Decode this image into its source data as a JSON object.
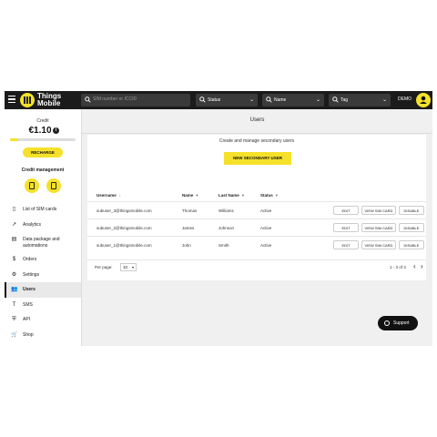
{
  "brand": {
    "logo_text": "Things Mobile"
  },
  "header": {
    "search_placeholder": "SIM number or ICCID",
    "filters": [
      {
        "label": "Status",
        "icon": "search-icon"
      },
      {
        "label": "Name",
        "icon": "search-icon"
      },
      {
        "label": "Tag",
        "icon": "search-icon"
      }
    ],
    "account_label": "DEMO"
  },
  "sidebar": {
    "credit_label": "Credit",
    "credit_value": "€1.10",
    "credit_fill_fraction": 0.12,
    "recharge_label": "RECHARGE",
    "credit_management_label": "Credit management",
    "items": [
      {
        "label": "List of SIM cards",
        "icon": "sim-card-icon"
      },
      {
        "label": "Analytics",
        "icon": "analytics-icon"
      },
      {
        "label": "Data package and automations",
        "icon": "data-package-icon"
      },
      {
        "label": "Orders",
        "icon": "dollar-icon"
      },
      {
        "label": "Settings",
        "icon": "gear-icon"
      },
      {
        "label": "Users",
        "icon": "users-icon",
        "active": true
      },
      {
        "label": "SMS",
        "icon": "sms-icon"
      },
      {
        "label": "API",
        "icon": "api-shield-icon"
      },
      {
        "label": "Shop",
        "icon": "cart-icon"
      }
    ]
  },
  "main": {
    "title": "Users",
    "subtitle": "Create and manage secondary users",
    "new_user_label": "NEW SECONDARY USER",
    "table": {
      "columns": [
        "Username",
        "Name",
        "Last Name",
        "Status"
      ],
      "rows": [
        {
          "username": "subuser_3@thingsmobile.com",
          "name": "Thomas",
          "last_name": "Williams",
          "status": "Active"
        },
        {
          "username": "subuser_2@thingsmobile.com",
          "name": "James",
          "last_name": "Johnson",
          "status": "Active"
        },
        {
          "username": "subuser_1@thingsmobile.com",
          "name": "John",
          "last_name": "Smith",
          "status": "Active"
        }
      ],
      "row_actions": [
        "EDIT",
        "VIEW SIM CARD",
        "DISABLE"
      ]
    },
    "pagination": {
      "per_page_label": "Per page:",
      "per_page_value": "10",
      "range_label": "1 - 3 of 3"
    }
  },
  "support_label": "Support",
  "colors": {
    "accent": "#f5e12a",
    "topbar": "#1b1b1b"
  }
}
